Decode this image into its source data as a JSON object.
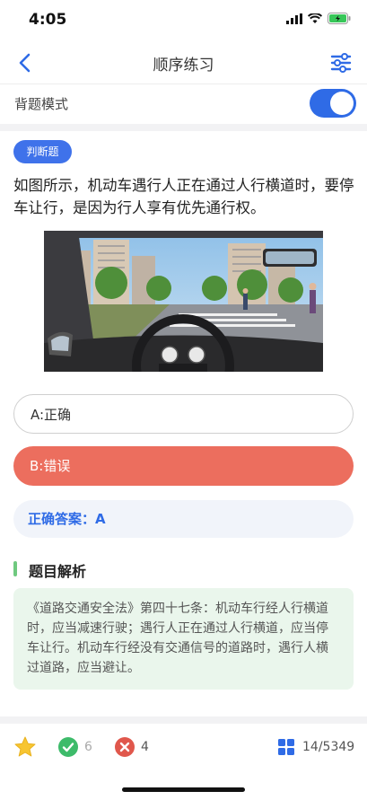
{
  "status": {
    "time": "4:05"
  },
  "nav": {
    "title": "顺序练习",
    "back_icon": "chevron-left-icon",
    "settings_icon": "sliders-icon"
  },
  "mode": {
    "label": "背题模式",
    "enabled": true
  },
  "question": {
    "type_label": "判断题",
    "text": "如图所示，机动车遇行人正在通过人行横道时，要停车让行，是因为行人享有优先通行权。"
  },
  "options": [
    {
      "label": "A:正确",
      "state": "default"
    },
    {
      "label": "B:错误",
      "state": "selected-wrong"
    }
  ],
  "answer": {
    "text": "正确答案：A"
  },
  "analysis": {
    "title": "题目解析",
    "text": "《道路交通安全法》第四十七条：机动车行经人行横道时，应当减速行驶；遇行人正在通过人行横道，应当停车让行。机动车行经没有交通信号的道路时，遇行人横过道路，应当避让。"
  },
  "bottom_bar": {
    "correct_count": "6",
    "wrong_count": "4",
    "progress": "14/5349"
  },
  "colors": {
    "accent": "#2f6be6",
    "wrong": "#ec6e5e",
    "correct": "#3dbb6a",
    "analysis_bg": "#eaf6ec"
  }
}
